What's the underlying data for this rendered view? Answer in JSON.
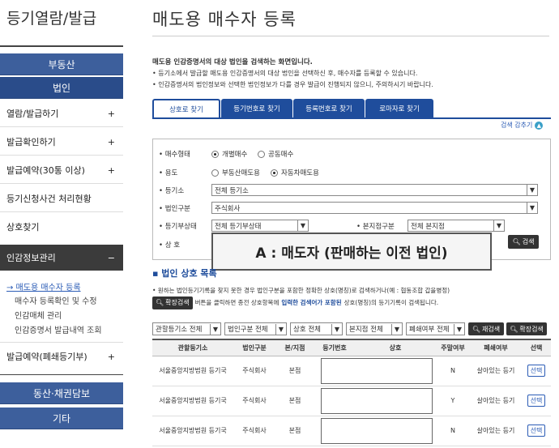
{
  "sidebar": {
    "title": "등기열람/발급",
    "buttons": [
      "부동산",
      "법인"
    ],
    "menu": [
      {
        "label": "열람/발급하기",
        "mark": "+"
      },
      {
        "label": "발급확인하기",
        "mark": "+"
      },
      {
        "label": "발급예약(30통 이상)",
        "mark": "+"
      },
      {
        "label": "등기신청사건 처리현황",
        "mark": ""
      },
      {
        "label": "상호찾기",
        "mark": ""
      },
      {
        "label": "인감정보관리",
        "mark": "−"
      }
    ],
    "submenu": [
      "→ 매도용 매수자 등록",
      "매수자 등록확인 및 수정",
      "인감매체 관리",
      "인감증명서 발급내역 조회"
    ],
    "menu2": {
      "label": "발급예약(폐쇄등기부)",
      "mark": "+"
    },
    "bottom_buttons": [
      "동산·채권담보",
      "기타"
    ]
  },
  "main": {
    "title": "매도용 매수자 등록",
    "intro_title": "매도용 인감증명서의 대상 법인을 검색하는 화면입니다.",
    "intro_1": "• 등기소에서 발급할 매도용 인감증명서의 대상 법인을 선택하신 후, 매수자를 등록할 수 있습니다.",
    "intro_2": "• 인감증명서의 법인정보와 선택한 법인정보가 다를 경우 발급이 진행되지 않으니, 주의하시기 바랍니다.",
    "tabs": [
      "상호로 찾기",
      "등기번호로 찾기",
      "등록번호로 찾기",
      "로마자로 찾기"
    ],
    "collapse": "검색 감추기",
    "form": {
      "buyer_type_label": "• 매수형태",
      "buyer_type_opts": [
        "개별매수",
        "공동매수"
      ],
      "usage_label": "• 용도",
      "usage_opts": [
        "부동산매도용",
        "자동차매도용"
      ],
      "registry_label": "• 등기소",
      "registry_value": "전체 등기소",
      "corp_type_label": "• 법인구분",
      "corp_type_value": "주식회사",
      "status_label": "• 등기부상태",
      "status_value": "전체 등기부상태",
      "branch_label": "• 본지점구분",
      "branch_value": "전체 본지점",
      "name_label": "• 상 호",
      "search_btn": "검색"
    },
    "overlay": "A : 매도자 (판매하는 이전 법인)",
    "list_title": "법인 상호 목록",
    "note_1": "• 원하는 법인등기기록을 찾지 못한 경우 법인구분을 포함한 정확한 상호(명칭)로 검색하거나(예 : 협동조합 갑을병정)",
    "note_2a": "확장검색",
    "note_2b": "버튼을 클릭하면 종전 상호항목에",
    "note_2c": "입력한 검색어가 포함된",
    "note_2d": "상호(명칭)의 등기기록이 검색됩니다.",
    "filters": [
      "관할등기소 전체",
      "법인구분 전체",
      "상호 전체",
      "본지점 전체",
      "폐쇄여부 전체"
    ],
    "filter_btns": [
      "재검색",
      "확장검색"
    ],
    "columns": [
      "관할등기소",
      "법인구분",
      "본/지점",
      "등기번호",
      "상호",
      "주말여부",
      "폐쇄여부",
      "선택"
    ],
    "rows": [
      {
        "office": "서울중앙지방법원 등기국",
        "type": "주식회사",
        "branch": "본점",
        "weekend": "N",
        "closed": "살아있는 등기",
        "pick": "선택"
      },
      {
        "office": "서울중앙지방법원 등기국",
        "type": "주식회사",
        "branch": "본점",
        "weekend": "Y",
        "closed": "살아있는 등기",
        "pick": "선택"
      },
      {
        "office": "서울중앙지방법원 등기국",
        "type": "주식회사",
        "branch": "본점",
        "weekend": "N",
        "closed": "살아있는 등기",
        "pick": "선택"
      }
    ]
  }
}
